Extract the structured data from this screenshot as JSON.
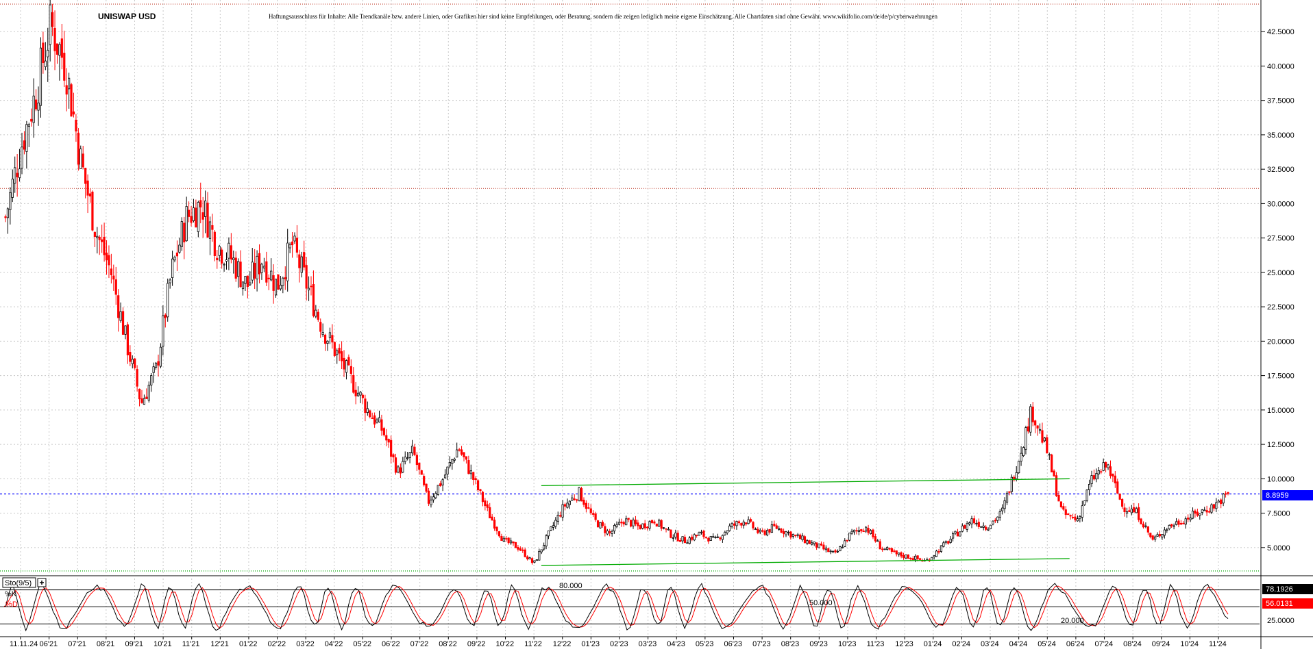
{
  "chart_data": {
    "type": "candlestick",
    "title": "UNISWAP USD",
    "disclaimer": "Haftungsausschluss für Inhalte: Alle Trendkanäle bzw. andere Linien, oder Grafiken hier sind keine Empfehlungen, oder Beratung, sondern die zeigen lediglich meine eigene Einschätzung. Alle Chartdaten sind ohne Gewähr.  www.wikifolio.com/de/de/p/cyberwaehrungen",
    "last_price": "8.8959",
    "y_ticks": [
      "42.5000",
      "40.0000",
      "37.5000",
      "35.0000",
      "32.5000",
      "30.0000",
      "27.5000",
      "25.0000",
      "22.5000",
      "20.0000",
      "17.5000",
      "15.0000",
      "12.5000",
      "10.0000",
      "7.5000",
      "5.0000"
    ],
    "y_tick_values": [
      42.5,
      40,
      37.5,
      35,
      32.5,
      30,
      27.5,
      25,
      22.5,
      20,
      17.5,
      15,
      12.5,
      10,
      7.5,
      5
    ],
    "ylim": [
      3.1,
      44.6
    ],
    "x_ticks": [
      "11.11.24",
      "06'21",
      "07'21",
      "08'21",
      "09'21",
      "10'21",
      "11'21",
      "12'21",
      "01'22",
      "02'22",
      "03'22",
      "04'22",
      "05'22",
      "06'22",
      "07'22",
      "08'22",
      "09'22",
      "10'22",
      "11'22",
      "12'22",
      "01'23",
      "02'23",
      "03'23",
      "04'23",
      "05'23",
      "06'23",
      "07'23",
      "08'23",
      "09'23",
      "10'23",
      "11'23",
      "12'23",
      "01'24",
      "02'24",
      "03'24",
      "04'24",
      "05'24",
      "06'24",
      "07'24",
      "08'24",
      "09'24",
      "10'24",
      "11'24"
    ],
    "series": [
      {
        "name": "close",
        "points": [
          [
            0,
            29
          ],
          [
            2,
            34
          ],
          [
            4,
            38
          ],
          [
            6,
            43
          ],
          [
            8,
            40
          ],
          [
            10,
            33
          ],
          [
            12,
            28
          ],
          [
            14,
            25
          ],
          [
            16,
            20
          ],
          [
            18,
            15.5
          ],
          [
            20,
            18
          ],
          [
            22,
            25
          ],
          [
            24,
            29
          ],
          [
            26,
            30
          ],
          [
            28,
            27
          ],
          [
            30,
            26
          ],
          [
            32,
            24
          ],
          [
            34,
            26
          ],
          [
            36,
            24
          ],
          [
            38,
            27
          ],
          [
            40,
            24
          ],
          [
            42,
            21
          ],
          [
            44,
            19
          ],
          [
            46,
            17
          ],
          [
            48,
            15
          ],
          [
            50,
            13.5
          ],
          [
            52,
            10.5
          ],
          [
            54,
            12
          ],
          [
            56,
            8.3
          ],
          [
            58,
            10
          ],
          [
            60,
            12.3
          ],
          [
            62,
            10
          ],
          [
            64,
            7.5
          ],
          [
            66,
            5.5
          ],
          [
            68,
            5
          ],
          [
            70,
            3.8
          ],
          [
            72,
            6
          ],
          [
            74,
            8
          ],
          [
            76,
            9
          ],
          [
            78,
            7
          ],
          [
            80,
            6
          ],
          [
            82,
            7
          ],
          [
            84,
            6.5
          ],
          [
            86,
            7
          ],
          [
            88,
            6
          ],
          [
            90,
            5.5
          ],
          [
            92,
            6
          ],
          [
            94,
            5.5
          ],
          [
            96,
            6.5
          ],
          [
            98,
            7
          ],
          [
            100,
            6
          ],
          [
            102,
            6.5
          ],
          [
            104,
            6
          ],
          [
            106,
            5.5
          ],
          [
            108,
            5
          ],
          [
            110,
            4.5
          ],
          [
            112,
            6
          ],
          [
            114,
            6.5
          ],
          [
            116,
            5
          ],
          [
            118,
            4.5
          ],
          [
            120,
            4.3
          ],
          [
            122,
            4
          ],
          [
            124,
            5
          ],
          [
            126,
            6
          ],
          [
            128,
            7
          ],
          [
            130,
            6.5
          ],
          [
            132,
            7.5
          ],
          [
            134,
            11
          ],
          [
            136,
            15
          ],
          [
            138,
            12
          ],
          [
            140,
            7.5
          ],
          [
            142,
            7
          ],
          [
            144,
            10
          ],
          [
            146,
            11
          ],
          [
            148,
            8
          ],
          [
            150,
            7.5
          ],
          [
            152,
            5.5
          ],
          [
            154,
            6.5
          ],
          [
            156,
            7
          ],
          [
            158,
            7.5
          ],
          [
            160,
            8
          ],
          [
            162,
            8.8959
          ]
        ]
      }
    ],
    "channel_lines": [
      {
        "color": "#00aa00",
        "from": [
          71,
          9.5
        ],
        "to": [
          141,
          10.0
        ]
      },
      {
        "color": "#00aa00",
        "from": [
          71,
          3.7
        ],
        "to": [
          141,
          4.2
        ]
      }
    ],
    "last_price_line": {
      "value": 8.8959,
      "color": "#0000ff"
    },
    "upper_ref_line": {
      "value": 31.1,
      "color": "#c85040"
    },
    "top_ref_line": {
      "value": 44.5,
      "color": "#c85040"
    },
    "bottom_ref_line": {
      "value": 3.3,
      "color": "#00aa00"
    },
    "colors": {
      "up": "#000000",
      "down": "#ff0000",
      "last_price_bg": "#0000ff",
      "k_bg": "#000000",
      "d_bg": "#ff0000"
    },
    "stochastic": {
      "label": "Sto(9/5)",
      "expand_icon": "plus-box-icon",
      "k_label": "%K",
      "d_label": ".%D",
      "k_value": "78.1926",
      "d_value": "56.0131",
      "levels": [
        {
          "label": "80.000",
          "value": 80
        },
        {
          "label": "50.000",
          "value": 50
        },
        {
          "label": "20.000",
          "value": 20
        }
      ],
      "right_tick": "25.0000",
      "ylim": [
        0,
        100
      ]
    }
  }
}
